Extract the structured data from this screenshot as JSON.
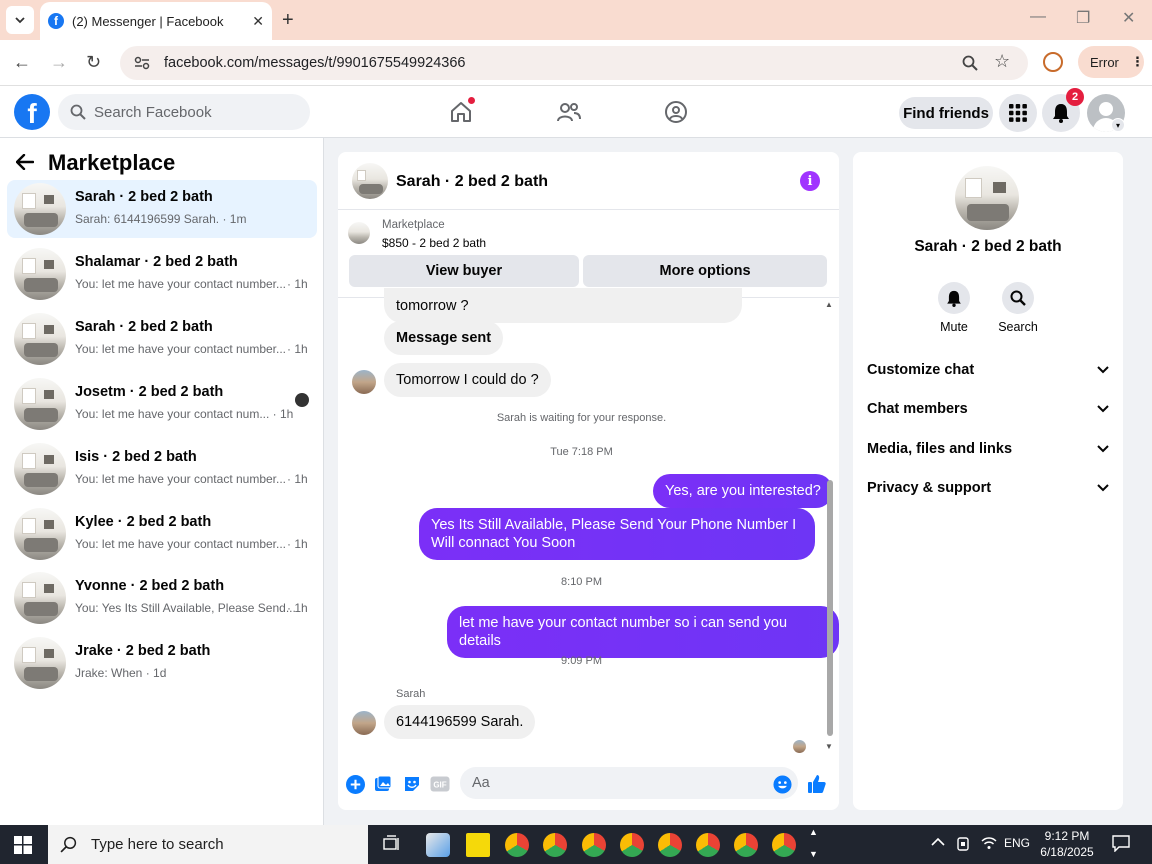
{
  "browser": {
    "tab_title": "(2) Messenger | Facebook",
    "url": "facebook.com/messages/t/9901675549924366",
    "profile_status": "Error"
  },
  "fb_header": {
    "search_placeholder": "Search Facebook",
    "find_friends_label": "Find friends",
    "notification_count": "2"
  },
  "sidebar": {
    "title": "Marketplace",
    "conversations": [
      {
        "title": "Sarah · 2 bed 2 bath",
        "preview": "Sarah: 6144196599 Sarah.",
        "time": " · 1m"
      },
      {
        "title": "Shalamar · 2 bed 2 bath",
        "preview": "You: let me have your contact number...",
        "time": " · 1h"
      },
      {
        "title": "Sarah · 2 bed 2 bath",
        "preview": "You: let me have your contact number...",
        "time": " · 1h"
      },
      {
        "title": "Josetm · 2 bed 2 bath",
        "preview": "You: let me have your contact num...",
        "time": " · 1h"
      },
      {
        "title": "Isis · 2 bed 2 bath",
        "preview": "You: let me have your contact number...",
        "time": " · 1h"
      },
      {
        "title": "Kylee · 2 bed 2 bath",
        "preview": "You: let me have your contact number...",
        "time": " · 1h"
      },
      {
        "title": "Yvonne · 2 bed 2 bath",
        "preview": "You: Yes Its Still Available, Please Send...",
        "time": " · 1h"
      },
      {
        "title": "Jrake · 2 bed 2 bath",
        "preview": "Jrake: When",
        "time": " · 1d"
      }
    ]
  },
  "chat": {
    "title": "Sarah · 2 bed 2 bath",
    "listing_label": "Marketplace",
    "listing_price": "$850 - 2 bed 2 bath",
    "view_buyer_label": "View buyer",
    "more_options_label": "More options",
    "messages": {
      "m1": "tomorrow ?",
      "m2": "Message sent",
      "m3": "Tomorrow I could do ?",
      "waiting_notice": "Sarah is waiting for your response.",
      "ts1": "Tue 7:18 PM",
      "m4": "Yes, are you interested?",
      "m5": "Yes Its Still Available, Please Send Your Phone Number I Will connact You Soon",
      "ts2": "8:10 PM",
      "m6": "let me have your contact number so i can send you details",
      "ts3": "9:09 PM",
      "sender_name": "Sarah",
      "m7": "6144196599 Sarah."
    },
    "composer_placeholder": "Aa"
  },
  "right_panel": {
    "name": "Sarah · 2 bed 2 bath",
    "mute_label": "Mute",
    "search_label": "Search",
    "sections": [
      "Customize chat",
      "Chat members",
      "Media, files and links",
      "Privacy & support"
    ]
  },
  "taskbar": {
    "search_placeholder": "Type here to search",
    "language": "ENG",
    "time": "9:12 PM",
    "date": "6/18/2025"
  },
  "colors": {
    "fb_blue": "#1877f2",
    "messenger_purple": "#7b2ff7",
    "badge_red": "#e41e3f",
    "active_row": "#e7f3ff"
  }
}
